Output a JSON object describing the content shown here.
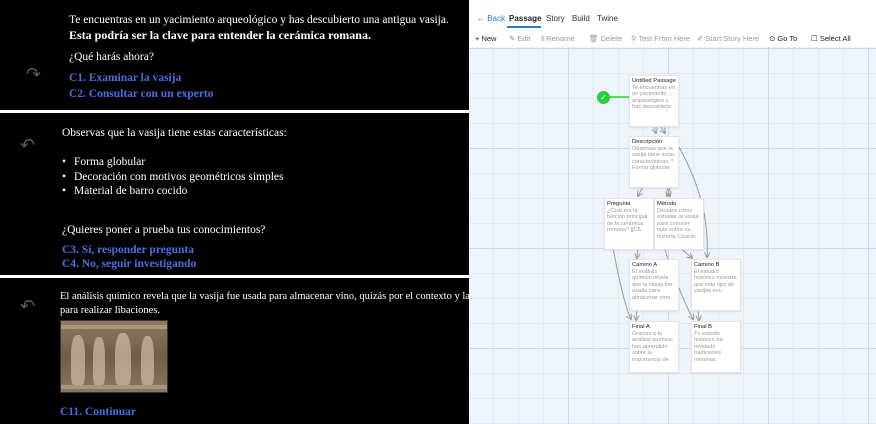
{
  "story": {
    "panel1": {
      "intro": "Te encuentras en un yacimiento arqueológico y has descubierto una antigua vasija.",
      "bold": "Esta podría ser la clave para entender la cerámica romana.",
      "question": "¿Qué harás ahora?",
      "links": [
        "C1. Examinar la vasija",
        "C2. Consultar con un experto"
      ]
    },
    "panel2": {
      "intro": "Observas que la vasija tiene estas características:",
      "features": [
        "Forma globular",
        "Decoración con motivos geométricos simples",
        "Material de barro cocido"
      ],
      "question": "¿Quieres poner a prueba tus conocimientos?",
      "links": [
        "C3. Sí, responder pregunta",
        "C4. No, seguir investigando"
      ]
    },
    "panel3": {
      "line1": "El análisis químico revela que la vasija fue usada para almacenar vino, quizás por el contexto y la tipología",
      "line2": "para realizar libaciones.",
      "link": "C11. Continuar"
    }
  },
  "editor": {
    "nav": {
      "back": "← Back",
      "tabs": [
        "Passage",
        "Story",
        "Build",
        "Twine"
      ],
      "active": "Passage"
    },
    "toolbar": [
      "+ New",
      "Edit",
      "Rename",
      "Delete",
      "Test From Here",
      "Start Story Here",
      "Go To",
      "Select All"
    ],
    "toolbar_icons": [
      "plus-icon",
      "pencil-icon",
      "rename-icon",
      "trash-icon",
      "test-icon",
      "rocket-icon",
      "goto-icon",
      "select-icon"
    ],
    "passages": [
      {
        "title": "Untitled Passage",
        "excerpt": "Te encuentras en un yacimiento arqueológico y has descubierto"
      },
      {
        "title": "Descripción",
        "excerpt": "Observas que la vasija tiene estas características: * Forma globular"
      },
      {
        "title": "Pregunta",
        "excerpt": "¿Cuál era la función principal de la cerámica romana? [[C5."
      },
      {
        "title": "Método",
        "excerpt": "Decides cómo estudiar la vasija para conocer más sobre su historia. Usarás"
      },
      {
        "title": "Camino A",
        "excerpt": "El análisis químico revela que la vasija fue usada para almacenar vino."
      },
      {
        "title": "Camino B",
        "excerpt": "El estudio histórico muestra que este tipo de vasijas era"
      },
      {
        "title": "Final A",
        "excerpt": "Gracias a tu análisis químico, has aprendido sobre la importancia de"
      },
      {
        "title": "Final B",
        "excerpt": "Tu estudio histórico ha revelado tradiciones romanas"
      }
    ],
    "start_icon": "rocket-icon",
    "colors": {
      "accent": "#2a7ad1",
      "start": "#2ecc40",
      "link": "#4b6fe0"
    }
  }
}
